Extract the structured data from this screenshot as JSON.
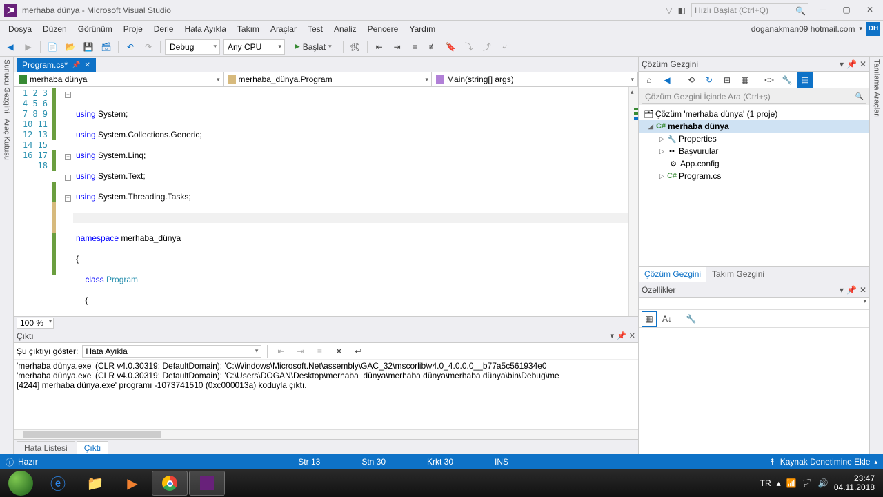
{
  "title": "merhaba dünya - Microsoft Visual Studio",
  "quickLaunch": {
    "placeholder": "Hızlı Başlat (Ctrl+Q)"
  },
  "menu": [
    "Dosya",
    "Düzen",
    "Görünüm",
    "Proje",
    "Derle",
    "Hata Ayıkla",
    "Takım",
    "Araçlar",
    "Test",
    "Analiz",
    "Pencere",
    "Yardım"
  ],
  "user": {
    "email": "doganakman09 hotmail.com",
    "initials": "DH"
  },
  "toolbar": {
    "config": "Debug",
    "platform": "Any CPU",
    "start": "Başlat"
  },
  "leftRail": [
    "Sunucu Gezgini",
    "Araç Kutusu"
  ],
  "docTab": {
    "name": "Program.cs*"
  },
  "nav": {
    "scope": "merhaba dünya",
    "type": "merhaba_dünya.Program",
    "member": "Main(string[] args)"
  },
  "code": {
    "lines": 18,
    "highlightLine": 13
  },
  "zoom": "100 %",
  "output": {
    "title": "Çıktı",
    "showLabel": "Şu çıktıyı göster:",
    "source": "Hata Ayıkla",
    "lines": [
      "'merhaba dünya.exe' (CLR v4.0.30319: DefaultDomain): 'C:\\Windows\\Microsoft.Net\\assembly\\GAC_32\\mscorlib\\v4.0_4.0.0.0__b77a5c561934e0",
      "'merhaba dünya.exe' (CLR v4.0.30319: DefaultDomain): 'C:\\Users\\DOGAN\\Desktop\\merhaba  dünya\\merhaba dünya\\merhaba dünya\\bin\\Debug\\me",
      "[4244] merhaba dünya.exe' programı -1073741510 (0xc000013a) koduyla çıktı."
    ]
  },
  "bottomTabs": {
    "errorList": "Hata Listesi",
    "output": "Çıktı"
  },
  "solutionExplorer": {
    "title": "Çözüm Gezgini",
    "searchPlaceholder": "Çözüm Gezgini İçinde Ara (Ctrl+ş)",
    "root": "Çözüm 'merhaba dünya' (1 proje)",
    "project": "merhaba dünya",
    "nodes": [
      "Properties",
      "Başvurular",
      "App.config",
      "Program.cs"
    ],
    "tabs": {
      "solution": "Çözüm Gezgini",
      "team": "Takım Gezgini"
    }
  },
  "properties": {
    "title": "Özellikler"
  },
  "rightRail": "Tanılama Araçları",
  "status": {
    "ready": "Hazır",
    "line": "Str 13",
    "col": "Stn 30",
    "char": "Krkt 30",
    "ins": "INS",
    "scm": "Kaynak Denetimine Ekle"
  },
  "tray": {
    "lang": "TR",
    "time": "23:47",
    "date": "04.11.2018"
  }
}
